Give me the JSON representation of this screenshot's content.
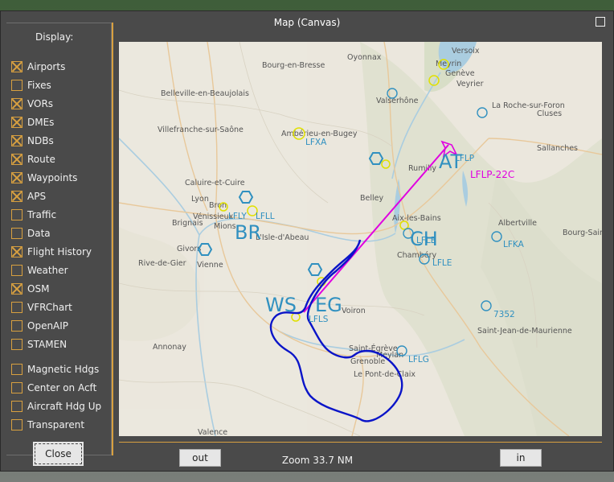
{
  "window": {
    "title": "Map (Canvas)"
  },
  "sidebar": {
    "heading": "Display:",
    "options": [
      {
        "label": "Airports",
        "checked": true
      },
      {
        "label": "Fixes",
        "checked": false
      },
      {
        "label": "VORs",
        "checked": true
      },
      {
        "label": "DMEs",
        "checked": true
      },
      {
        "label": "NDBs",
        "checked": true
      },
      {
        "label": "Route",
        "checked": true
      },
      {
        "label": "Waypoints",
        "checked": true
      },
      {
        "label": "APS",
        "checked": true
      },
      {
        "label": "Traffic",
        "checked": false
      },
      {
        "label": "Data",
        "checked": false
      },
      {
        "label": "Flight History",
        "checked": true
      },
      {
        "label": "Weather",
        "checked": false
      },
      {
        "label": "OSM",
        "checked": true
      },
      {
        "label": "VFRChart",
        "checked": false
      },
      {
        "label": "OpenAIP",
        "checked": false
      },
      {
        "label": "STAMEN",
        "checked": false
      }
    ],
    "settings": [
      {
        "label": "Magnetic Hdgs",
        "checked": false
      },
      {
        "label": "Center on Acft",
        "checked": false
      },
      {
        "label": "Aircraft Hdg Up",
        "checked": false
      },
      {
        "label": "Transparent",
        "checked": false
      }
    ],
    "close_label": "Close"
  },
  "map": {
    "towns": [
      "Bourg-en-Bresse",
      "Oyonnax",
      "Versoix",
      "Meyrin",
      "Genève",
      "Veyrier",
      "Belleville-en-Beaujolais",
      "Valserhône",
      "La Roche-sur-Foron",
      "Cluses",
      "Villefranche-sur-Saône",
      "Ambérieu-en-Bugey",
      "Sallanches",
      "Rumilly",
      "Caluire-et-Cuire",
      "Lyon",
      "Bron",
      "Vénissieux",
      "Mions",
      "Brignais",
      "Belley",
      "Albertville",
      "Aix-les-Bains",
      "Bourg-Saint-Maurice",
      "L'Isle-d'Abeau",
      "Givors",
      "Chambéry",
      "Rive-de-Gier",
      "Vienne",
      "Voiron",
      "Saint-Jean-de-Maurienne",
      "Annonay",
      "Saint-Égrève",
      "Meylan",
      "Grenoble",
      "Le Pont-de-Claix",
      "Valence"
    ],
    "nav_labels": [
      "LFXA",
      "LFLP",
      "LFLP-22C",
      "LFLY",
      "LFLL",
      "LFLB",
      "LFLE",
      "LFKA",
      "LFLS",
      "LFLG",
      "7352"
    ],
    "vor_labels": [
      "AT",
      "BR",
      "CH",
      "WS",
      "EG"
    ],
    "colors": {
      "airport": "#e0e000",
      "navaid": "#3090c0",
      "route": "#e000e0",
      "history": "#0a14c8"
    }
  },
  "controls": {
    "zoom_out_label": "out",
    "zoom_text": "Zoom 33.7 NM",
    "zoom_in_label": "in"
  }
}
